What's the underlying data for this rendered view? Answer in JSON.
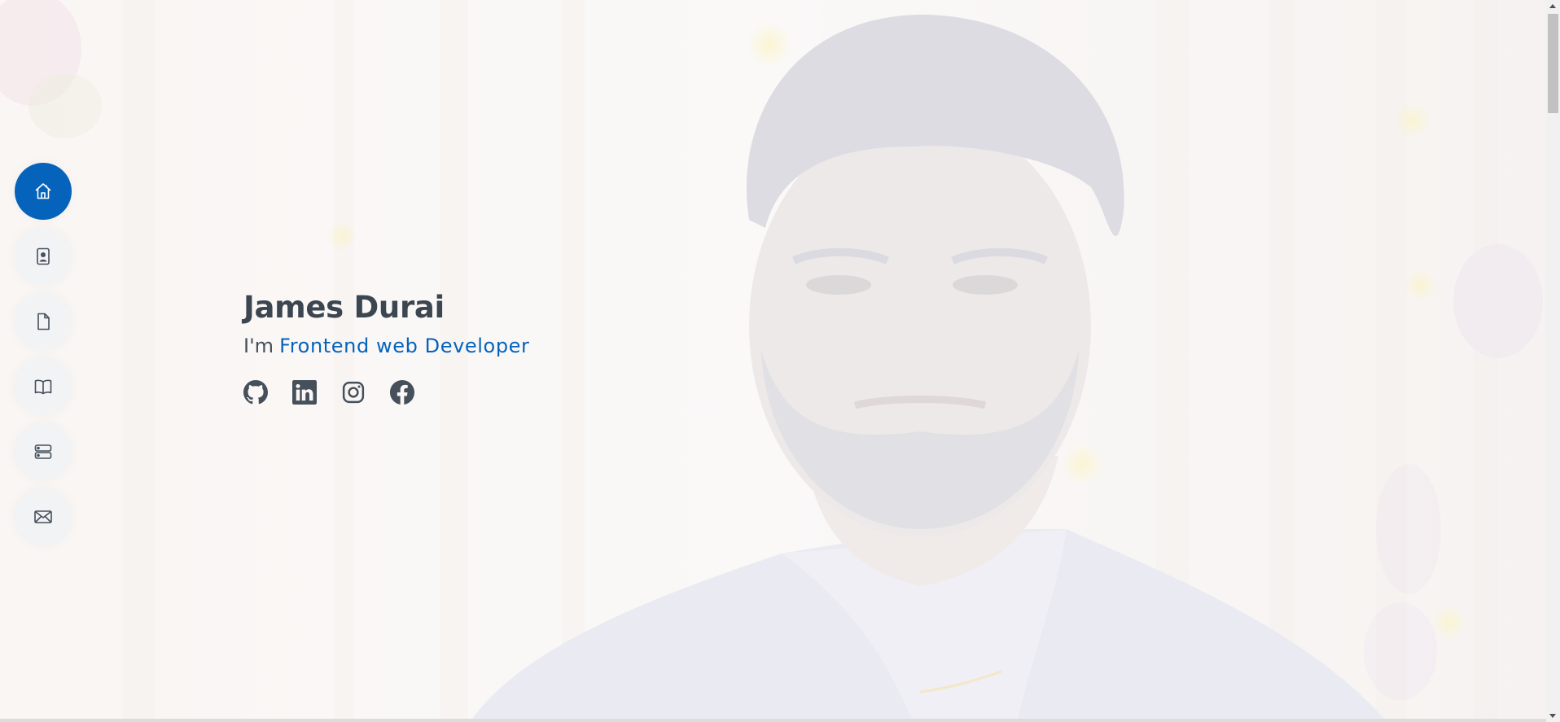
{
  "nav": {
    "items": [
      {
        "id": "home",
        "icon": "house-icon",
        "active": true
      },
      {
        "id": "about",
        "icon": "person-badge-icon",
        "active": false
      },
      {
        "id": "resume",
        "icon": "file-icon",
        "active": false
      },
      {
        "id": "portfolio",
        "icon": "book-icon",
        "active": false
      },
      {
        "id": "services",
        "icon": "server-icon",
        "active": false
      },
      {
        "id": "contact",
        "icon": "envelope-icon",
        "active": false
      }
    ]
  },
  "hero": {
    "name": "James Durai",
    "role_prefix": "I'm",
    "role_typed": "Frontend web Developer"
  },
  "socials": [
    {
      "id": "github",
      "icon": "github-icon"
    },
    {
      "id": "linkedin",
      "icon": "linkedin-icon"
    },
    {
      "id": "instagram",
      "icon": "instagram-icon"
    },
    {
      "id": "facebook",
      "icon": "facebook-icon"
    }
  ],
  "colors": {
    "accent": "#0563bb",
    "text": "#45505b",
    "nav_bg": "#f2f3f5"
  }
}
